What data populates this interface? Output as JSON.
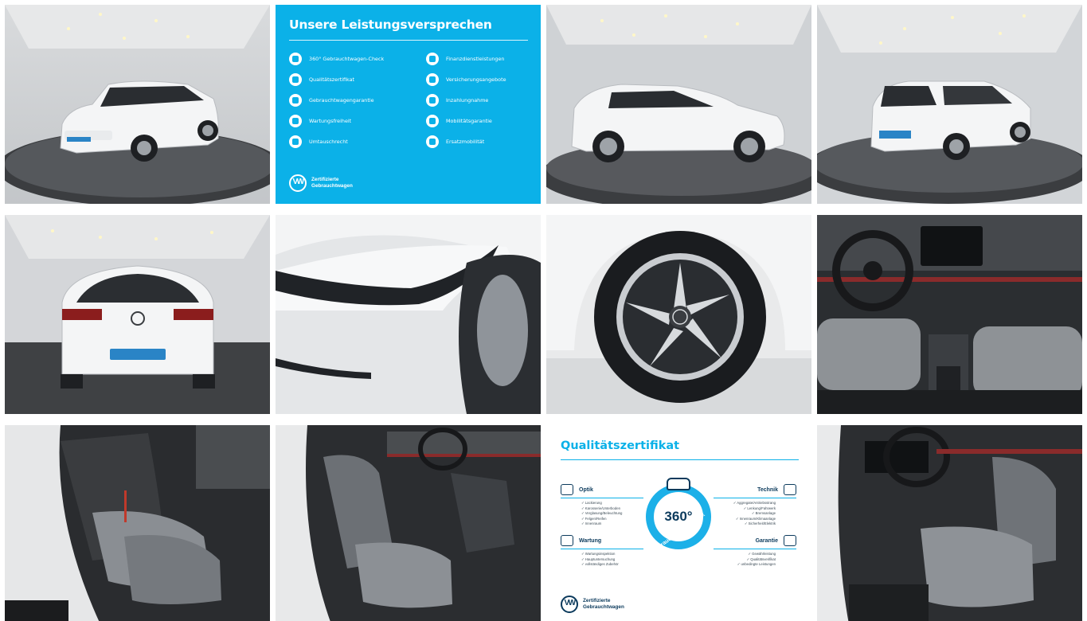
{
  "gallery": {
    "photos": [
      {
        "name": "front-three-quarter"
      },
      {
        "name": "side-profile"
      },
      {
        "name": "rear-three-quarter"
      },
      {
        "name": "rear-view"
      },
      {
        "name": "headlight-detail"
      },
      {
        "name": "wheel-detail"
      },
      {
        "name": "cockpit"
      },
      {
        "name": "rear-seats"
      },
      {
        "name": "front-seats-passenger"
      },
      {
        "name": "front-seats-driver"
      }
    ]
  },
  "promo": {
    "title": "Unsere Leistungsversprechen",
    "items": [
      {
        "label": "360° Gebrauchtwagen-Check"
      },
      {
        "label": "Finanzdienstleistungen"
      },
      {
        "label": "Qualitätszertifikat"
      },
      {
        "label": "Versicherungsangebote"
      },
      {
        "label": "Gebrauchtwagengarantie"
      },
      {
        "label": "Inzahlungnahme"
      },
      {
        "label": "Wartungsfreiheit"
      },
      {
        "label": "Mobilitätsgarantie"
      },
      {
        "label": "Umtauschrecht"
      },
      {
        "label": "Ersatzmobilität"
      }
    ],
    "footer_line1": "Zertifizierte",
    "footer_line2": "Gebrauchtwagen"
  },
  "certificate": {
    "title": "Qualitätszertifikat",
    "badge_value": "360°",
    "badge_arc": "Gebrauchtwagen-Check",
    "sections": {
      "optik": {
        "title": "Optik",
        "items": [
          "Lackierung",
          "Karosserie/Unterboden",
          "Verglasung/Beleuchtung",
          "Felgen/Reifen",
          "Innenraum"
        ]
      },
      "technik": {
        "title": "Technik",
        "items": [
          "Aggregate/Antriebsstrang",
          "Lenkung/Fahrwerk",
          "Bremsanlage",
          "Innenraum/Klimaanlage",
          "Sicherheit/Elektrik"
        ]
      },
      "wartung": {
        "title": "Wartung",
        "items": [
          "Wartungsinspektion",
          "Hauptuntersuchung",
          "vollständiges Zubehör"
        ]
      },
      "garantie": {
        "title": "Garantie",
        "items": [
          "Gewährleistung",
          "Qualitätsverifikat",
          "unbedingte Leistungen"
        ]
      }
    },
    "footer_line1": "Zertifizierte",
    "footer_line2": "Gebrauchtwagen"
  },
  "colors": {
    "brand_cyan": "#0bb1e8",
    "navy": "#0b3a5c",
    "car_white": "#f4f5f6"
  }
}
